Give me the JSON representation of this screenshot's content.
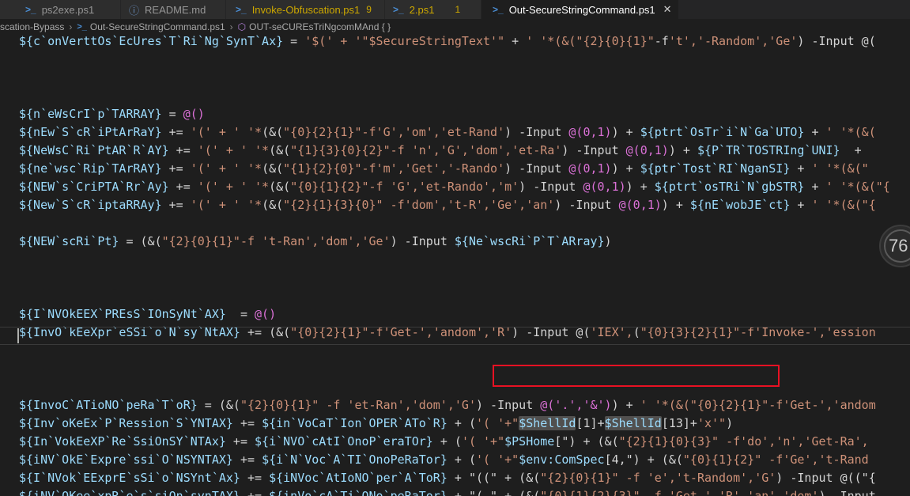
{
  "tabs": [
    {
      "label": "ps2exe.ps1",
      "icon": "powershell-icon",
      "badge": "",
      "warn": false
    },
    {
      "label": "README.md",
      "icon": "info-icon",
      "badge": "",
      "warn": false
    },
    {
      "label": "Invoke-Obfuscation.ps1",
      "icon": "powershell-icon",
      "badge": "9",
      "warn": true
    },
    {
      "label": "2.ps1",
      "icon": "powershell-icon",
      "badge": "1",
      "warn": true
    },
    {
      "label": "Out-SecureStringCommand.ps1",
      "icon": "powershell-icon",
      "badge": "",
      "warn": false,
      "active": true
    }
  ],
  "breadcrumb": {
    "folder": "scation-Bypass",
    "file": "Out-SecureStringCommand.ps1",
    "symbol": "OUT-seCUREsTriNgcomMAnd { }"
  },
  "zoom_indicator": "76",
  "colors": {
    "variable": "#9cdcfe",
    "string": "#ce9178",
    "bracket": "#ffd700",
    "paren": "#da70d6",
    "number": "#b5cea8",
    "highlight_box": "#e81123"
  },
  "code_lines": [
    [
      [
        "v",
        "${c`onVerttOs`EcUres`T`Ri`Ng`SynT`Ax}"
      ],
      [
        "p",
        " = "
      ],
      [
        "s",
        "'$(' + '\"$SecureStringText'\""
      ],
      [
        "p",
        " + "
      ],
      [
        "s",
        "' '*(&("
      ],
      [
        "s",
        "\"{2}{0}{1}\""
      ],
      [
        "p",
        "-f"
      ],
      [
        "s",
        "'t','-Random','Ge'"
      ],
      [
        "p",
        ") -Input @("
      ]
    ],
    [],
    [],
    [],
    [
      [
        "v",
        "${n`eWsCrI`p`TARRAY}"
      ],
      [
        "p",
        " = "
      ],
      [
        "m",
        "@()"
      ]
    ],
    [
      [
        "v",
        "${nEw`S`cR`iPtArRaY}"
      ],
      [
        "p",
        " += "
      ],
      [
        "s",
        "'(' + ' '*"
      ],
      [
        "p",
        "(&("
      ],
      [
        "s",
        "\"{0}{2}{1}\"-f'G','om','et-Rand'"
      ],
      [
        "p",
        ") -Input "
      ],
      [
        "m",
        "@(0,1)"
      ],
      [
        "p",
        ") + "
      ],
      [
        "v",
        "${ptrt`OsTr`i`N`Ga`UTO}"
      ],
      [
        "p",
        " + "
      ],
      [
        "s",
        "' '*(&("
      ]
    ],
    [
      [
        "v",
        "${NeWsC`Ri`PtAR`R`AY}"
      ],
      [
        "p",
        " += "
      ],
      [
        "s",
        "'(' + ' '*"
      ],
      [
        "p",
        "(&("
      ],
      [
        "s",
        "\"{1}{3}{0}{2}\"-f 'n','G','dom','et-Ra'"
      ],
      [
        "p",
        ") -Input "
      ],
      [
        "m",
        "@(0,1)"
      ],
      [
        "p",
        ") + "
      ],
      [
        "v",
        "${P`TR`TOSTRIng`UNI}"
      ],
      [
        "p",
        "  + "
      ]
    ],
    [
      [
        "v",
        "${ne`wsc`Rip`TArRAY}"
      ],
      [
        "p",
        " += "
      ],
      [
        "s",
        "'(' + ' '*"
      ],
      [
        "p",
        "(&("
      ],
      [
        "s",
        "\"{1}{2}{0}\"-f'm','Get','-Rando'"
      ],
      [
        "p",
        ") -Input "
      ],
      [
        "m",
        "@(0,1)"
      ],
      [
        "p",
        ") + "
      ],
      [
        "v",
        "${ptr`Tost`RI`NganSI}"
      ],
      [
        "p",
        " + "
      ],
      [
        "s",
        "' '*(&(\""
      ]
    ],
    [
      [
        "v",
        "${NEW`s`CriPTA`Rr`Ay}"
      ],
      [
        "p",
        " += "
      ],
      [
        "s",
        "'(' + ' '*"
      ],
      [
        "p",
        "(&("
      ],
      [
        "s",
        "\"{0}{1}{2}\"-f 'G','et-Rando','m'"
      ],
      [
        "p",
        ") -Input "
      ],
      [
        "m",
        "@(0,1)"
      ],
      [
        "p",
        ") + "
      ],
      [
        "v",
        "${ptrt`osTRi`N`gbSTR}"
      ],
      [
        "p",
        " + "
      ],
      [
        "s",
        "' '*(&(\"{"
      ]
    ],
    [
      [
        "v",
        "${New`S`cR`iptaRRAy}"
      ],
      [
        "p",
        " += "
      ],
      [
        "s",
        "'(' + ' '*"
      ],
      [
        "p",
        "(&("
      ],
      [
        "s",
        "\"{2}{1}{3}{0}\" -f'dom','t-R','Ge','an'"
      ],
      [
        "p",
        ") -Input "
      ],
      [
        "m",
        "@(0,1)"
      ],
      [
        "p",
        ") + "
      ],
      [
        "v",
        "${nE`wobJE`ct}"
      ],
      [
        "p",
        " + "
      ],
      [
        "s",
        "' '*(&(\"{"
      ]
    ],
    [],
    [
      [
        "v",
        "${NEW`scRi`Pt}"
      ],
      [
        "p",
        " = (&("
      ],
      [
        "s",
        "\"{2}{0}{1}\"-f 't-Ran','dom','Ge'"
      ],
      [
        "p",
        ") -Input "
      ],
      [
        "v",
        "${Ne`wscRi`P`T`ARray}"
      ],
      [
        "p",
        ")"
      ]
    ],
    [],
    [],
    [],
    [
      [
        "v",
        "${I`NVOkEEX`PREsS`IOnSyNt`AX}"
      ],
      [
        "p",
        "  = "
      ],
      [
        "m",
        "@()"
      ]
    ],
    [
      [
        "v",
        "${InvO`kEeXpr`eSSi`o`N`sy`NtAX}"
      ],
      [
        "p",
        " += (&("
      ],
      [
        "s",
        "\"{0}{2}{1}\"-f'Get-','andom','R'"
      ],
      [
        "p",
        ") -Input @("
      ],
      [
        "s",
        "'IEX',"
      ],
      [
        "p",
        "("
      ],
      [
        "s",
        "\"{0}{3}{2}{1}\"-f'Invoke-','ession"
      ]
    ],
    [],
    [],
    [],
    [
      [
        "v",
        "${InvoC`ATioNO`peRa`T`oR}"
      ],
      [
        "p",
        " = (&("
      ],
      [
        "s",
        "\"{2}{0}{1}\" -f 'et-Ran','dom','G'"
      ],
      [
        "p",
        ") -Input "
      ],
      [
        "m",
        "@('.','&')"
      ],
      [
        "p",
        ") + "
      ],
      [
        "s",
        "' '*(&(\"{0}{2}{1}\"-f'Get-','andom"
      ]
    ],
    [
      [
        "v",
        "${Inv`oKeEx`P`Ression`S`YNTAX}"
      ],
      [
        "p",
        " += "
      ],
      [
        "v",
        "${in`VoCaT`Ion`OPER`ATo`R}"
      ],
      [
        "p",
        " + ("
      ],
      [
        "s",
        "'( '+\""
      ],
      [
        "v",
        "$ShellId"
      ],
      [
        "p",
        "[1]+"
      ],
      [
        "v",
        "$ShellId"
      ],
      [
        "p",
        "[13]+"
      ],
      [
        "s",
        "'x'\""
      ],
      [
        "p",
        ")"
      ]
    ],
    [
      [
        "v",
        "${In`VokEeXP`Re`SsiOnSY`NTAx}"
      ],
      [
        "p",
        " += "
      ],
      [
        "v",
        "${i`NVO`cAtI`OnoP`eraTOr}"
      ],
      [
        "p",
        " + ("
      ],
      [
        "s",
        "'( '+\""
      ],
      [
        "v",
        "$PSHome"
      ],
      [
        "p",
        "[\") + (&("
      ],
      [
        "s",
        "\"{2}{1}{0}{3}\" -f'do','n','Get-Ra',"
      ]
    ],
    [
      [
        "v",
        "${iNV`OkE`Expre`ssi`O`NSYNTAX}"
      ],
      [
        "p",
        " += "
      ],
      [
        "v",
        "${i`N`Voc`A`TI`OnoPeRaTor}"
      ],
      [
        "p",
        " + ("
      ],
      [
        "s",
        "'( '+\""
      ],
      [
        "v",
        "$env:ComSpec"
      ],
      [
        "p",
        "[4,\") + (&("
      ],
      [
        "s",
        "\"{0}{1}{2}\" -f'Ge','t-Rand"
      ]
    ],
    [
      [
        "v",
        "${I`NVok`EExprE`sSi`o`NSYnt`Ax}"
      ],
      [
        "p",
        " += "
      ],
      [
        "v",
        "${iNVoc`AtIoNO`per`A`ToR}"
      ],
      [
        "p",
        " + \"((\" + (&("
      ],
      [
        "s",
        "\"{2}{0}{1}\" -f 'e','t-Random','G'"
      ],
      [
        "p",
        ") -Input @((\"{"
      ]
    ],
    [
      [
        "v",
        "${iNV`OKee`xpR`e`s`siOn`synTAX}"
      ],
      [
        "p",
        " += "
      ],
      [
        "v",
        "${inVo`cA`Ti`ONo`peRaTor}"
      ],
      [
        "p",
        " + \"( \" + (&("
      ],
      [
        "s",
        "\"{0}{1}{2}{3}\" -f 'Get-','R','an','dom'"
      ],
      [
        "p",
        ") -Input"
      ]
    ]
  ]
}
